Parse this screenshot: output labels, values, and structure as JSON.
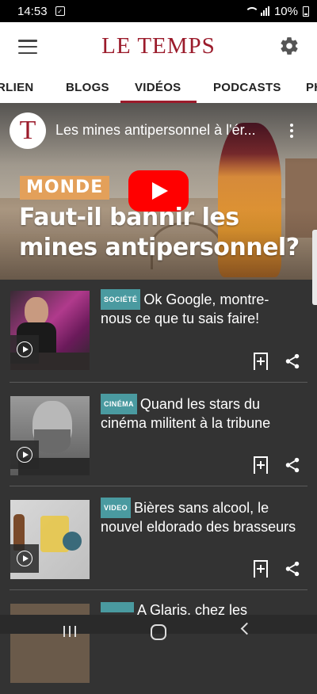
{
  "status_bar": {
    "time": "14:53",
    "battery": "10%",
    "notification_icon": "download-box-icon"
  },
  "app_bar": {
    "logo": "LE TEMPS",
    "menu_icon": "hamburger-menu-icon",
    "settings_icon": "gear-icon"
  },
  "tabs": [
    {
      "label": "RLIEN"
    },
    {
      "label": "BLOGS"
    },
    {
      "label": "VIDÉOS",
      "active": true
    },
    {
      "label": "PODCASTS"
    },
    {
      "label": "PH"
    }
  ],
  "hero": {
    "channel_logo": "T",
    "video_title": "Les mines antipersonnel à l'ér...",
    "tag": "MONDE",
    "headline": "Faut-il bannir les mines antipersonnel?",
    "play_icon": "youtube-play-icon"
  },
  "articles": [
    {
      "category": "SOCIÉTÉ",
      "title": "Ok Google, montre-nous ce que tu sais faire!"
    },
    {
      "category": "CINÉMA",
      "title": "Quand les stars du cinéma militent à la tribune"
    },
    {
      "category": "VIDEO",
      "title": "Bières sans alcool, le nouvel eldorado des brasseurs"
    },
    {
      "category": "",
      "title": "A Glaris, chez les"
    }
  ],
  "colors": {
    "brand": "#9b1b2b",
    "category_bg": "#4a9aa0",
    "hero_tag_bg": "#e3a05a",
    "background": "#333333"
  }
}
